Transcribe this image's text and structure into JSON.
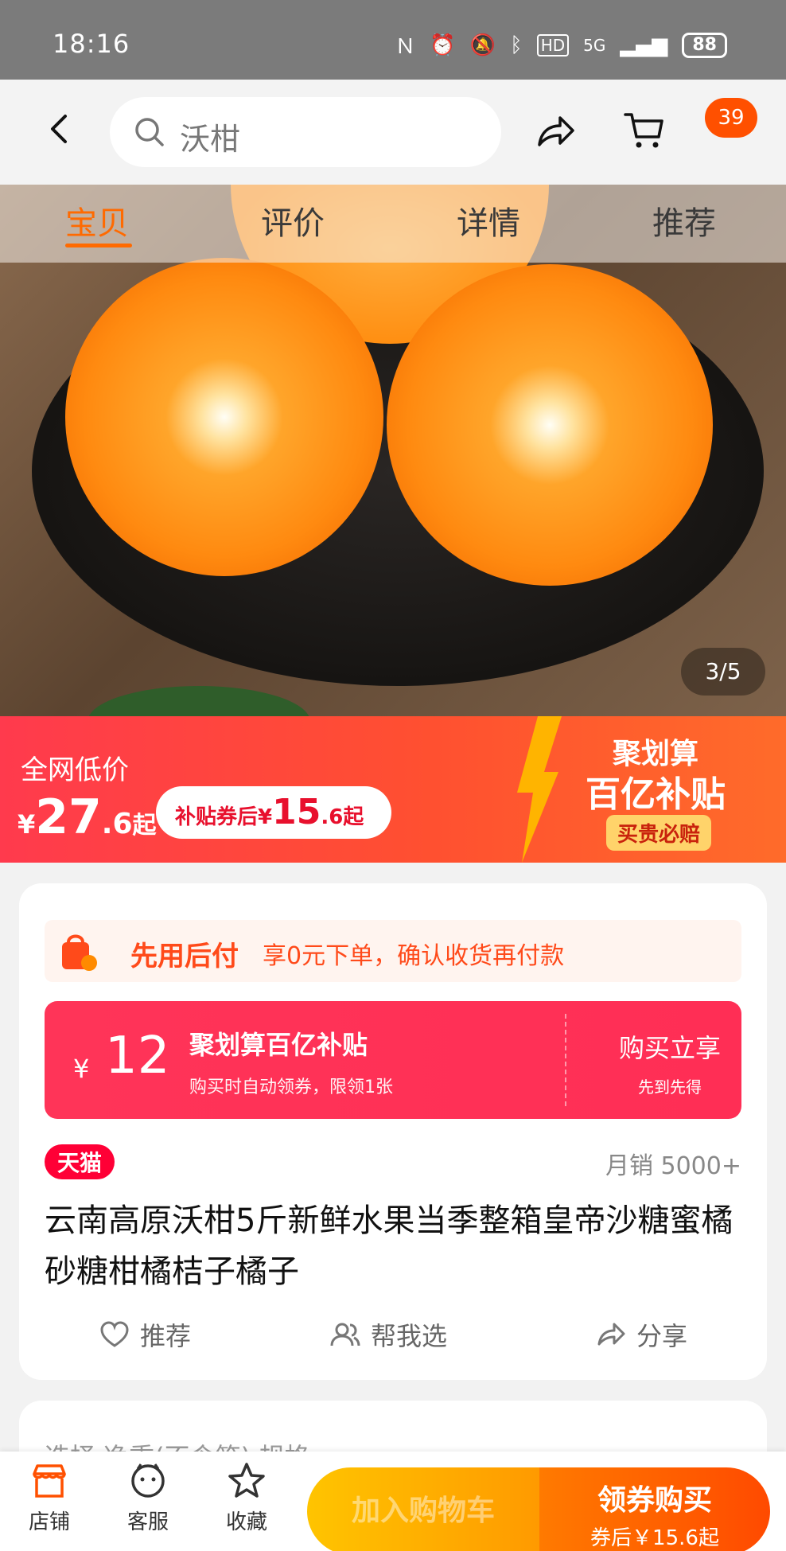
{
  "status_bar": {
    "time": "18:16",
    "network": "5G",
    "battery": "88"
  },
  "header": {
    "search_text": "沃柑",
    "cart_count": "39"
  },
  "hero": {
    "tabs": [
      "宝贝",
      "评价",
      "详情",
      "推荐"
    ],
    "active_tab": "宝贝",
    "image_counter": "3/5"
  },
  "price_banner": {
    "low_price_label": "全网低价",
    "currency": "¥",
    "price_int": "27",
    "price_dec": ".6",
    "price_suffix": "起",
    "coupon_label": "补贴券后¥",
    "coupon_int": "15",
    "coupon_dec": ".6",
    "coupon_suffix": "起",
    "promo_title": "聚划算",
    "promo_sub": "百亿补贴",
    "promo_badge": "买贵必赔"
  },
  "card": {
    "bnpl_title": "先用后付",
    "bnpl_desc": "享0元下单，确认收货再付款",
    "subsidy_currency": "¥",
    "subsidy_amount": "12",
    "subsidy_title": "聚划算百亿补贴",
    "subsidy_desc": "购买时自动领券，限领1张",
    "subsidy_action": "购买立享",
    "subsidy_action_sub": "先到先得",
    "store_tag": "天猫",
    "monthly_sales": "月销 5000+",
    "product_title": "云南高原沃柑5斤新鲜水果当季整箱皇帝沙糖蜜橘砂糖柑橘桔子橘子",
    "actions": [
      "推荐",
      "帮我选",
      "分享"
    ]
  },
  "spec_row": {
    "text": "选择    净重(不含箱) 规格"
  },
  "bottom_bar": {
    "nav": [
      "店铺",
      "客服",
      "收藏"
    ],
    "add_to_cart": "加入购物车",
    "buy_label": "领券购买",
    "buy_sub": "券后￥15.6起"
  },
  "colors": {
    "accent": "#ff5000",
    "tmall_red": "#ff0036",
    "subsidy_pink": "#ff3458"
  }
}
